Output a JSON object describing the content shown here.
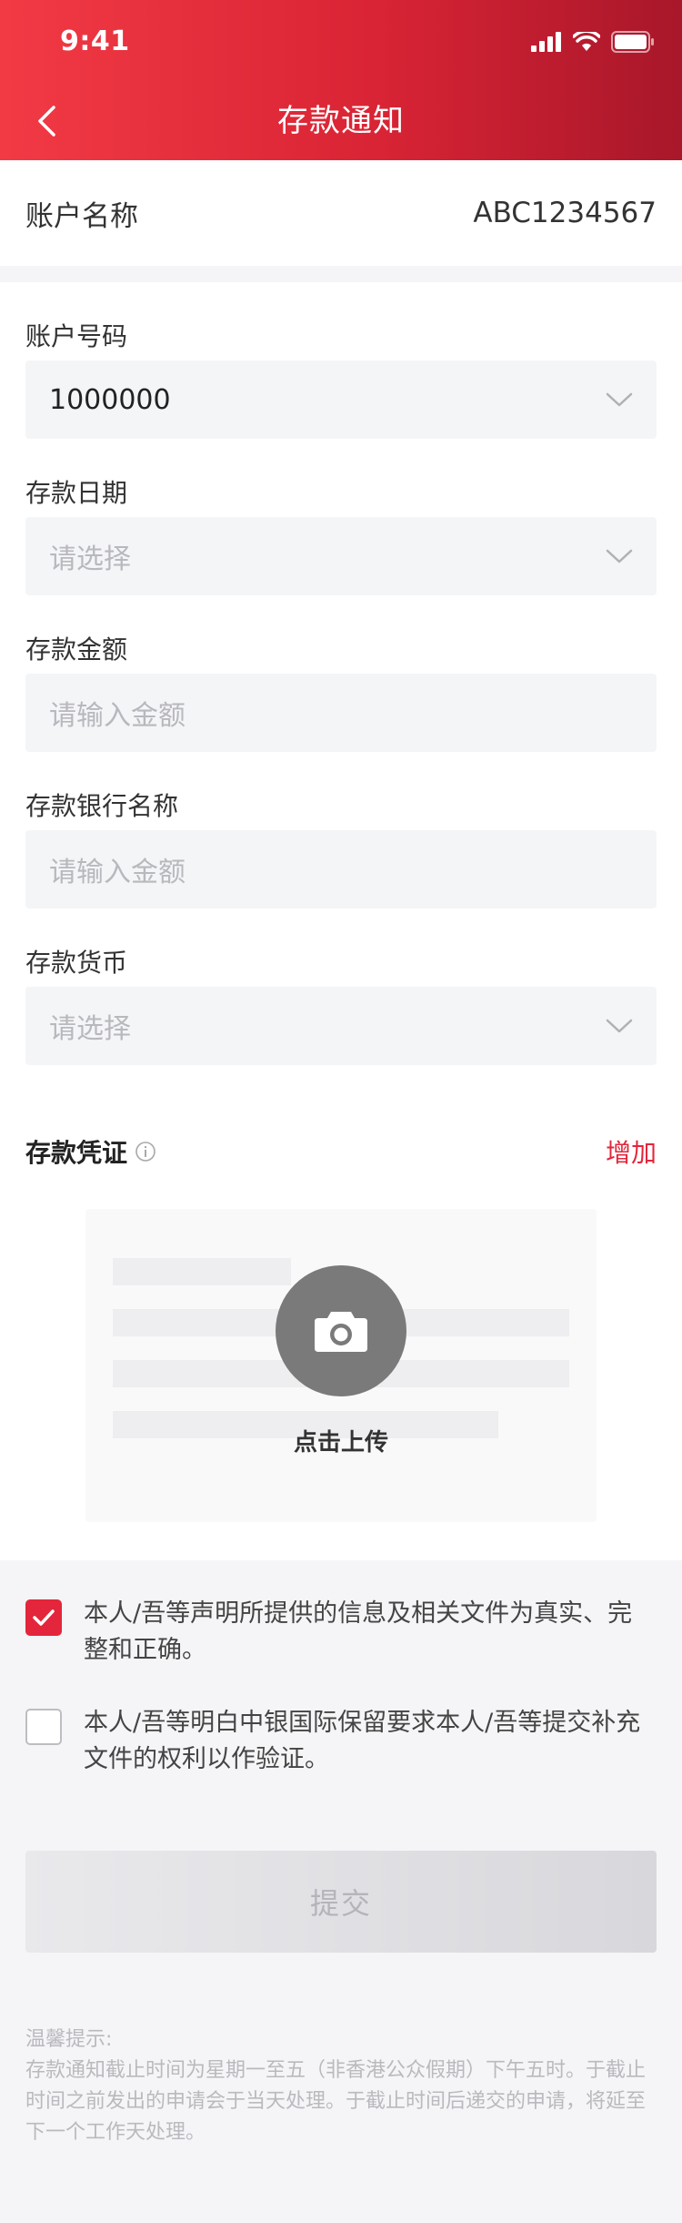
{
  "status_bar": {
    "time": "9:41"
  },
  "nav": {
    "title": "存款通知"
  },
  "account": {
    "name_label": "账户名称",
    "name_value": "ABC1234567"
  },
  "fields": {
    "account_no": {
      "label": "账户号码",
      "value": "1000000"
    },
    "deposit_date": {
      "label": "存款日期",
      "placeholder": "请选择"
    },
    "deposit_amount": {
      "label": "存款金额",
      "placeholder": "请输入金额"
    },
    "deposit_bank": {
      "label": "存款银行名称",
      "placeholder": "请输入金额"
    },
    "deposit_currency": {
      "label": "存款货币",
      "placeholder": "请选择"
    }
  },
  "voucher": {
    "label": "存款凭证",
    "add_label": "增加",
    "upload_label": "点击上传"
  },
  "declarations": [
    {
      "text": "本人/吾等声明所提供的信息及相关文件为真实、完整和正确。",
      "checked": true
    },
    {
      "text": "本人/吾等明白中银国际保留要求本人/吾等提交补充文件的权利以作验证。",
      "checked": false
    }
  ],
  "submit": {
    "label": "提交"
  },
  "tips": {
    "title": "温馨提示:",
    "body": "存款通知截止时间为星期一至五（非香港公众假期）下午五时。于截止时间之前发出的申请会于当天处理。于截止时间后递交的申请，将延至下一个工作天处理。"
  },
  "colors": {
    "brand_red": "#e3263b",
    "header_gradient_end": "#a8172a"
  },
  "icons": [
    "signal-icon",
    "wifi-icon",
    "battery-icon",
    "back-arrow-icon",
    "chevron-down-icon",
    "info-icon",
    "camera-icon",
    "checkmark-icon"
  ]
}
